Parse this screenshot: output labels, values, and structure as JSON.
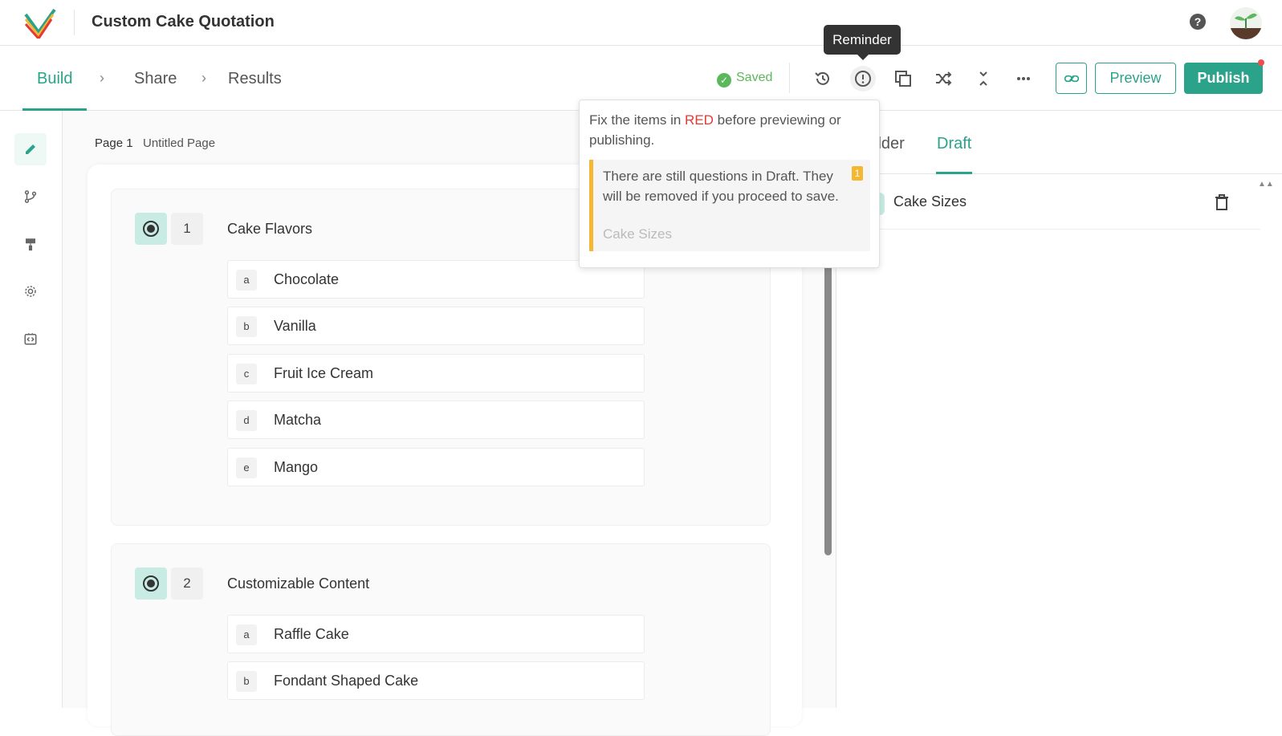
{
  "app": {
    "title": "Custom Cake Quotation"
  },
  "steps": [
    {
      "label": "Build"
    },
    {
      "label": "Share"
    },
    {
      "label": "Results"
    }
  ],
  "status": {
    "saved_label": "Saved"
  },
  "toolbar": {
    "tooltip": "Reminder",
    "preview_label": "Preview",
    "publish_label": "Publish"
  },
  "page": {
    "label": "Page 1",
    "name": "Untitled Page"
  },
  "questions": [
    {
      "number": "1",
      "title": "Cake Flavors",
      "options": [
        {
          "letter": "a",
          "label": "Chocolate"
        },
        {
          "letter": "b",
          "label": "Vanilla"
        },
        {
          "letter": "c",
          "label": "Fruit Ice Cream"
        },
        {
          "letter": "d",
          "label": "Matcha"
        },
        {
          "letter": "e",
          "label": "Mango"
        }
      ]
    },
    {
      "number": "2",
      "title": "Customizable Content",
      "options": [
        {
          "letter": "a",
          "label": "Raffle Cake"
        },
        {
          "letter": "b",
          "label": "Fondant Shaped Cake"
        }
      ]
    }
  ],
  "right_panel": {
    "tab_builder": "ilder",
    "tab_draft": "Draft",
    "draft_item": "Cake Sizes"
  },
  "reminder": {
    "msg_before": "Fix the items in ",
    "msg_red": "RED",
    "msg_after": " before previewing or publishing.",
    "warning": "There are still questions in Draft. They will be removed if you proceed to save.",
    "warning_item": "Cake Sizes",
    "count": "1"
  },
  "colors": {
    "accent": "#2aa38a",
    "warning": "#f5b731",
    "error": "#e53935"
  }
}
